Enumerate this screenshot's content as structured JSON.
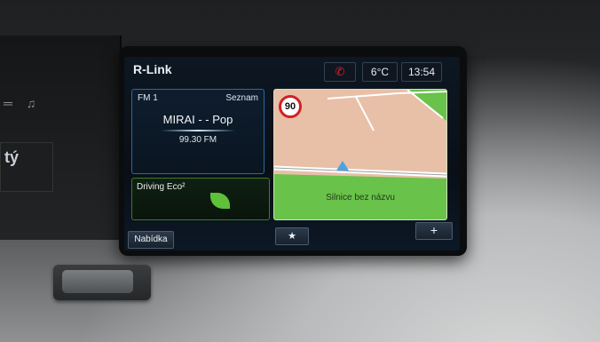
{
  "header": {
    "logo": "R-Link",
    "temperature": "6°C",
    "time": "13:54",
    "phone_icon": "phone-missed-icon"
  },
  "radio": {
    "band": "FM 1",
    "list_label": "Seznam",
    "station": "MIRAI - - Pop",
    "frequency": "99.30 FM"
  },
  "eco": {
    "title": "Driving Eco²",
    "icon": "leaf-icon"
  },
  "navigation": {
    "speed_limit": "90",
    "road_name": "Silnice bez názvu"
  },
  "footer": {
    "menu_label": "Nabídka",
    "star_label": "★",
    "plus_label": "+"
  },
  "left_panel": {
    "display_text": "tý"
  },
  "colors": {
    "screen_bg": "#0a0f16",
    "radio_border": "#2b67a8",
    "eco_border": "#3d7a2a",
    "eco_leaf": "#5fc03a",
    "map_ground": "#e8bfa7",
    "map_green": "#69c24a",
    "speed_sign_red": "#d21f26"
  }
}
